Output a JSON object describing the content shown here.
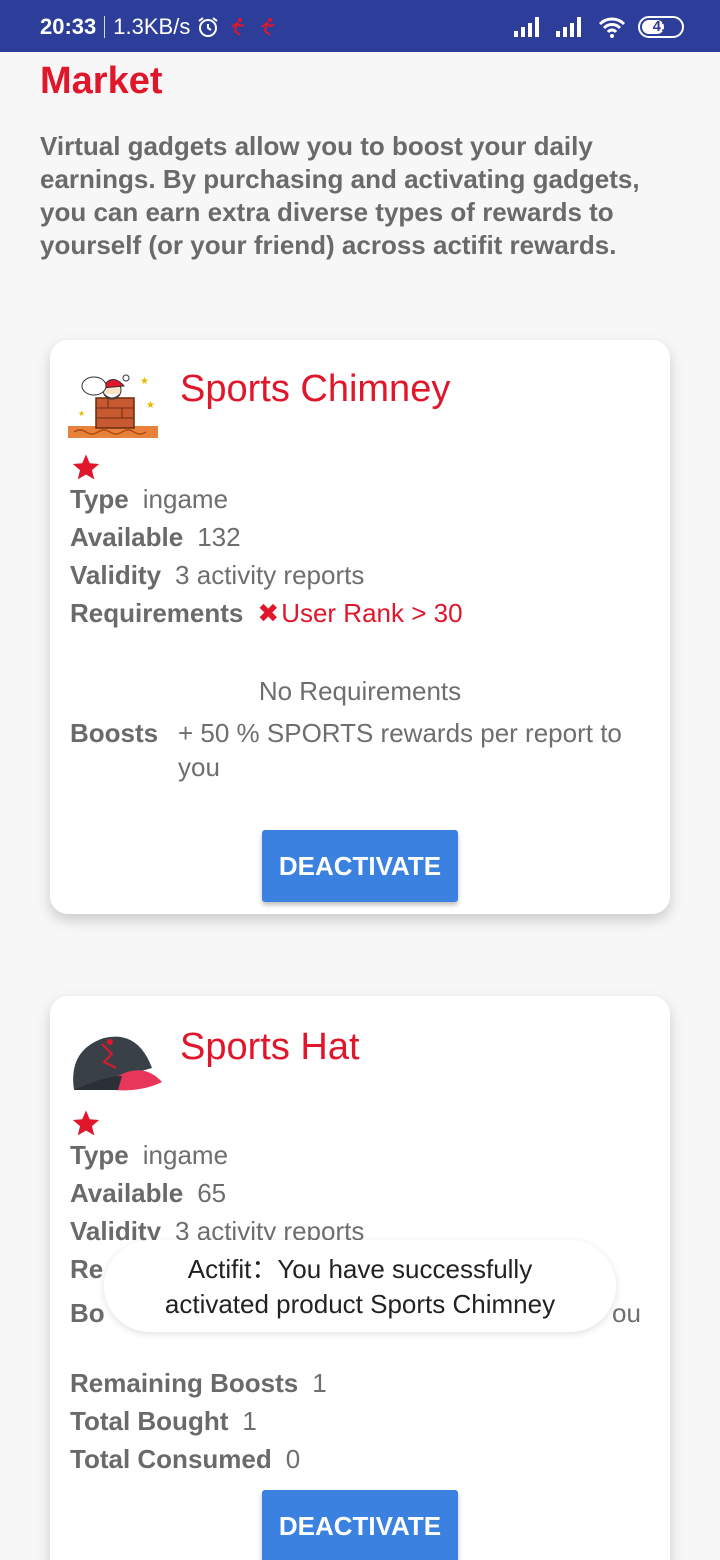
{
  "status_bar": {
    "time": "20:33",
    "net_speed": "1.3KB/s",
    "battery": "41",
    "icons": [
      "alarm-icon",
      "activity-icon",
      "activity-icon",
      "signal-icon",
      "signal-icon",
      "wifi-icon",
      "battery-icon"
    ]
  },
  "header": {
    "title": "Market",
    "intro": "Virtual gadgets allow you to boost your daily earnings. By purchasing and activating gadgets, you can earn extra diverse types of rewards to yourself (or your friend) across actifit rewards."
  },
  "products": [
    {
      "name": "Sports Chimney",
      "image": "santa-chimney-icon",
      "rating_icon": "star-icon",
      "type_label": "Type",
      "type_value": "ingame",
      "available_label": "Available",
      "available_value": "132",
      "validity_label": "Validity",
      "validity_value": "3 activity reports",
      "requirements_label": "Requirements",
      "requirement_fail_mark": "✖",
      "requirement_value": "User Rank > 30",
      "no_requirements": "No Requirements",
      "boosts_label": "Boosts",
      "boosts_value": "+ 50 % SPORTS rewards per report to you",
      "button_label": "DEACTIVATE"
    },
    {
      "name": "Sports Hat",
      "image": "cap-icon",
      "rating_icon": "star-icon",
      "type_label": "Type",
      "type_value": "ingame",
      "available_label": "Available",
      "available_value": "65",
      "validity_label": "Validity",
      "validity_value": "3 activity reports",
      "requirements_label": "Re",
      "boosts_label": "Bo",
      "boosts_tail": "ou",
      "remaining_label": "Remaining Boosts",
      "remaining_value": "1",
      "bought_label": "Total Bought",
      "bought_value": "1",
      "consumed_label": "Total Consumed",
      "consumed_value": "0",
      "button_label": "DEACTIVATE"
    }
  ],
  "toast": {
    "line1": "Actifit：You have successfully",
    "line2": "activated product Sports Chimney"
  },
  "colors": {
    "status_bar": "#2c3e99",
    "accent_red": "#e0162b",
    "button_blue": "#3b82e0",
    "text_gray": "#6e6e6e"
  }
}
